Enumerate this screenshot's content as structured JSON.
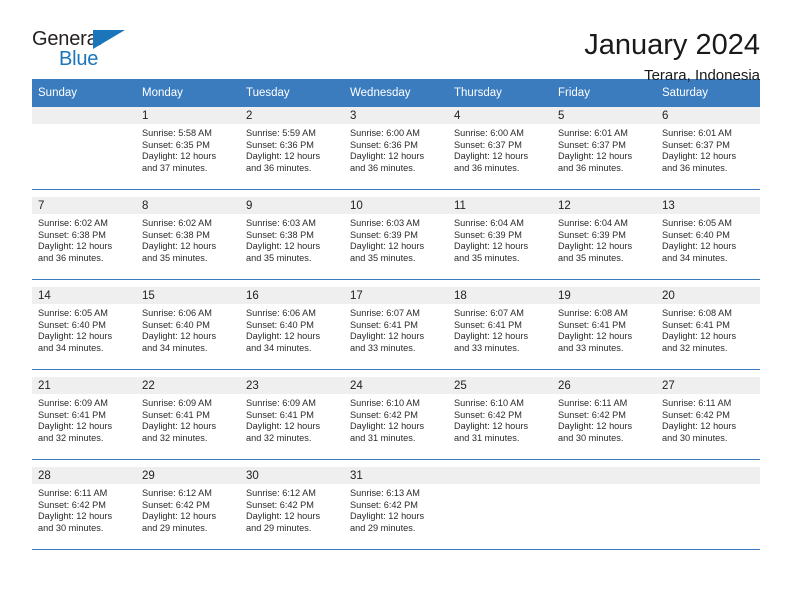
{
  "logo": {
    "word_top": "General",
    "word_bottom": "Blue",
    "triangle_color": "#1b75bb",
    "text_color": "#231f20"
  },
  "header": {
    "title": "January 2024",
    "location": "Terara, Indonesia"
  },
  "theme": {
    "header_blue": "#3a7cbe",
    "daynum_band": "#efefef",
    "text": "#2b2b2b"
  },
  "calendar": {
    "weekday_headers": [
      "Sunday",
      "Monday",
      "Tuesday",
      "Wednesday",
      "Thursday",
      "Friday",
      "Saturday"
    ],
    "weeks": [
      [
        {
          "day": "",
          "sunrise": "",
          "sunset": "",
          "daylight_line1": "",
          "daylight_line2": ""
        },
        {
          "day": "1",
          "sunrise": "Sunrise: 5:58 AM",
          "sunset": "Sunset: 6:35 PM",
          "daylight_line1": "Daylight: 12 hours",
          "daylight_line2": "and 37 minutes."
        },
        {
          "day": "2",
          "sunrise": "Sunrise: 5:59 AM",
          "sunset": "Sunset: 6:36 PM",
          "daylight_line1": "Daylight: 12 hours",
          "daylight_line2": "and 36 minutes."
        },
        {
          "day": "3",
          "sunrise": "Sunrise: 6:00 AM",
          "sunset": "Sunset: 6:36 PM",
          "daylight_line1": "Daylight: 12 hours",
          "daylight_line2": "and 36 minutes."
        },
        {
          "day": "4",
          "sunrise": "Sunrise: 6:00 AM",
          "sunset": "Sunset: 6:37 PM",
          "daylight_line1": "Daylight: 12 hours",
          "daylight_line2": "and 36 minutes."
        },
        {
          "day": "5",
          "sunrise": "Sunrise: 6:01 AM",
          "sunset": "Sunset: 6:37 PM",
          "daylight_line1": "Daylight: 12 hours",
          "daylight_line2": "and 36 minutes."
        },
        {
          "day": "6",
          "sunrise": "Sunrise: 6:01 AM",
          "sunset": "Sunset: 6:37 PM",
          "daylight_line1": "Daylight: 12 hours",
          "daylight_line2": "and 36 minutes."
        }
      ],
      [
        {
          "day": "7",
          "sunrise": "Sunrise: 6:02 AM",
          "sunset": "Sunset: 6:38 PM",
          "daylight_line1": "Daylight: 12 hours",
          "daylight_line2": "and 36 minutes."
        },
        {
          "day": "8",
          "sunrise": "Sunrise: 6:02 AM",
          "sunset": "Sunset: 6:38 PM",
          "daylight_line1": "Daylight: 12 hours",
          "daylight_line2": "and 35 minutes."
        },
        {
          "day": "9",
          "sunrise": "Sunrise: 6:03 AM",
          "sunset": "Sunset: 6:38 PM",
          "daylight_line1": "Daylight: 12 hours",
          "daylight_line2": "and 35 minutes."
        },
        {
          "day": "10",
          "sunrise": "Sunrise: 6:03 AM",
          "sunset": "Sunset: 6:39 PM",
          "daylight_line1": "Daylight: 12 hours",
          "daylight_line2": "and 35 minutes."
        },
        {
          "day": "11",
          "sunrise": "Sunrise: 6:04 AM",
          "sunset": "Sunset: 6:39 PM",
          "daylight_line1": "Daylight: 12 hours",
          "daylight_line2": "and 35 minutes."
        },
        {
          "day": "12",
          "sunrise": "Sunrise: 6:04 AM",
          "sunset": "Sunset: 6:39 PM",
          "daylight_line1": "Daylight: 12 hours",
          "daylight_line2": "and 35 minutes."
        },
        {
          "day": "13",
          "sunrise": "Sunrise: 6:05 AM",
          "sunset": "Sunset: 6:40 PM",
          "daylight_line1": "Daylight: 12 hours",
          "daylight_line2": "and 34 minutes."
        }
      ],
      [
        {
          "day": "14",
          "sunrise": "Sunrise: 6:05 AM",
          "sunset": "Sunset: 6:40 PM",
          "daylight_line1": "Daylight: 12 hours",
          "daylight_line2": "and 34 minutes."
        },
        {
          "day": "15",
          "sunrise": "Sunrise: 6:06 AM",
          "sunset": "Sunset: 6:40 PM",
          "daylight_line1": "Daylight: 12 hours",
          "daylight_line2": "and 34 minutes."
        },
        {
          "day": "16",
          "sunrise": "Sunrise: 6:06 AM",
          "sunset": "Sunset: 6:40 PM",
          "daylight_line1": "Daylight: 12 hours",
          "daylight_line2": "and 34 minutes."
        },
        {
          "day": "17",
          "sunrise": "Sunrise: 6:07 AM",
          "sunset": "Sunset: 6:41 PM",
          "daylight_line1": "Daylight: 12 hours",
          "daylight_line2": "and 33 minutes."
        },
        {
          "day": "18",
          "sunrise": "Sunrise: 6:07 AM",
          "sunset": "Sunset: 6:41 PM",
          "daylight_line1": "Daylight: 12 hours",
          "daylight_line2": "and 33 minutes."
        },
        {
          "day": "19",
          "sunrise": "Sunrise: 6:08 AM",
          "sunset": "Sunset: 6:41 PM",
          "daylight_line1": "Daylight: 12 hours",
          "daylight_line2": "and 33 minutes."
        },
        {
          "day": "20",
          "sunrise": "Sunrise: 6:08 AM",
          "sunset": "Sunset: 6:41 PM",
          "daylight_line1": "Daylight: 12 hours",
          "daylight_line2": "and 32 minutes."
        }
      ],
      [
        {
          "day": "21",
          "sunrise": "Sunrise: 6:09 AM",
          "sunset": "Sunset: 6:41 PM",
          "daylight_line1": "Daylight: 12 hours",
          "daylight_line2": "and 32 minutes."
        },
        {
          "day": "22",
          "sunrise": "Sunrise: 6:09 AM",
          "sunset": "Sunset: 6:41 PM",
          "daylight_line1": "Daylight: 12 hours",
          "daylight_line2": "and 32 minutes."
        },
        {
          "day": "23",
          "sunrise": "Sunrise: 6:09 AM",
          "sunset": "Sunset: 6:41 PM",
          "daylight_line1": "Daylight: 12 hours",
          "daylight_line2": "and 32 minutes."
        },
        {
          "day": "24",
          "sunrise": "Sunrise: 6:10 AM",
          "sunset": "Sunset: 6:42 PM",
          "daylight_line1": "Daylight: 12 hours",
          "daylight_line2": "and 31 minutes."
        },
        {
          "day": "25",
          "sunrise": "Sunrise: 6:10 AM",
          "sunset": "Sunset: 6:42 PM",
          "daylight_line1": "Daylight: 12 hours",
          "daylight_line2": "and 31 minutes."
        },
        {
          "day": "26",
          "sunrise": "Sunrise: 6:11 AM",
          "sunset": "Sunset: 6:42 PM",
          "daylight_line1": "Daylight: 12 hours",
          "daylight_line2": "and 30 minutes."
        },
        {
          "day": "27",
          "sunrise": "Sunrise: 6:11 AM",
          "sunset": "Sunset: 6:42 PM",
          "daylight_line1": "Daylight: 12 hours",
          "daylight_line2": "and 30 minutes."
        }
      ],
      [
        {
          "day": "28",
          "sunrise": "Sunrise: 6:11 AM",
          "sunset": "Sunset: 6:42 PM",
          "daylight_line1": "Daylight: 12 hours",
          "daylight_line2": "and 30 minutes."
        },
        {
          "day": "29",
          "sunrise": "Sunrise: 6:12 AM",
          "sunset": "Sunset: 6:42 PM",
          "daylight_line1": "Daylight: 12 hours",
          "daylight_line2": "and 29 minutes."
        },
        {
          "day": "30",
          "sunrise": "Sunrise: 6:12 AM",
          "sunset": "Sunset: 6:42 PM",
          "daylight_line1": "Daylight: 12 hours",
          "daylight_line2": "and 29 minutes."
        },
        {
          "day": "31",
          "sunrise": "Sunrise: 6:13 AM",
          "sunset": "Sunset: 6:42 PM",
          "daylight_line1": "Daylight: 12 hours",
          "daylight_line2": "and 29 minutes."
        },
        {
          "day": "",
          "sunrise": "",
          "sunset": "",
          "daylight_line1": "",
          "daylight_line2": ""
        },
        {
          "day": "",
          "sunrise": "",
          "sunset": "",
          "daylight_line1": "",
          "daylight_line2": ""
        },
        {
          "day": "",
          "sunrise": "",
          "sunset": "",
          "daylight_line1": "",
          "daylight_line2": ""
        }
      ]
    ]
  }
}
